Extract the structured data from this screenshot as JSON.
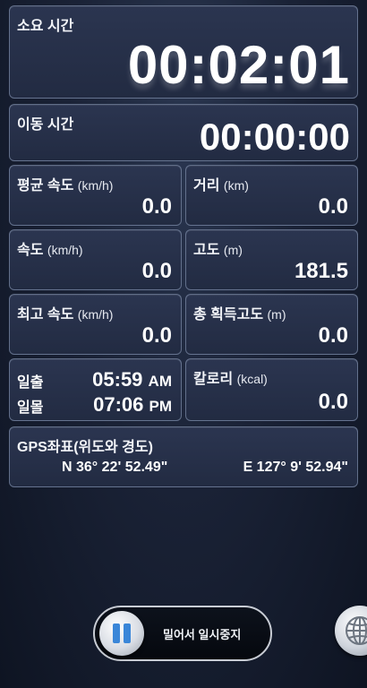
{
  "elapsed": {
    "label": "소요 시간",
    "value": "00:02:01"
  },
  "moving": {
    "label": "이동 시간",
    "value": "00:00:00"
  },
  "avg_speed": {
    "label": "평균 속도",
    "unit": "(km/h)",
    "value": "0.0"
  },
  "distance": {
    "label": "거리",
    "unit": "(km)",
    "value": "0.0"
  },
  "speed": {
    "label": "속도",
    "unit": "(km/h)",
    "value": "0.0"
  },
  "altitude": {
    "label": "고도",
    "unit": "(m)",
    "value": "181.5"
  },
  "max_speed": {
    "label": "최고 속도",
    "unit": "(km/h)",
    "value": "0.0"
  },
  "elevation_gain": {
    "label": "총 획득고도",
    "unit": "(m)",
    "value": "0.0"
  },
  "sun": {
    "sunrise_label": "일출",
    "sunrise_time": "05:59",
    "sunrise_ampm": "AM",
    "sunset_label": "일몰",
    "sunset_time": "07:06",
    "sunset_ampm": "PM"
  },
  "calories": {
    "label": "칼로리",
    "unit": "(kcal)",
    "value": "0.0"
  },
  "gps": {
    "label": "GPS좌표(위도와 경도)",
    "lat": "N 36° 22' 52.49\"",
    "lon": "E 127° 9' 52.94\""
  },
  "pause": {
    "label": "밀어서 일시중지",
    "icon": "pause-icon"
  },
  "globe": {
    "icon": "globe-icon"
  },
  "colors": {
    "panel": "#252e47",
    "panel_border": "#8f9bb5",
    "pause_icon": "#3a86d8"
  }
}
